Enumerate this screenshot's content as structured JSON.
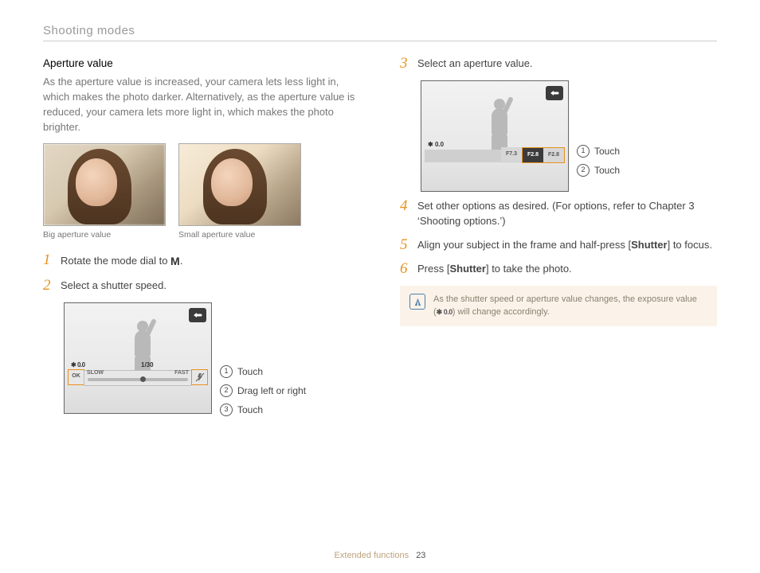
{
  "section_title": "Shooting modes",
  "left": {
    "subhead": "Aperture value",
    "body": "As the aperture value is increased, your camera lets less light in, which makes the photo darker. Alternatively, as the aperture value is reduced, your camera lets more light in, which makes the photo brighter.",
    "cap_big": "Big aperture value",
    "cap_small": "Small aperture value",
    "step1_pre": "Rotate the mode dial to ",
    "step1_post": ".",
    "mode_letter": "M",
    "step2": "Select a shutter speed.",
    "screen1": {
      "ev": "0.0",
      "shutter": "1/30",
      "slow": "SLOW",
      "fast": "FAST",
      "ok": "OK"
    },
    "callouts": {
      "c1_num": "1",
      "c1": "Touch",
      "c2_num": "2",
      "c2": "Drag left or right",
      "c3_num": "3",
      "c3": "Touch"
    }
  },
  "right": {
    "step3": "Select an aperture value.",
    "screen2": {
      "ev": "0.0",
      "f1": "F7.3",
      "f2": "F2.8",
      "f3": "F2.8"
    },
    "callouts2": {
      "c1_num": "1",
      "c1": "Touch",
      "c2_num": "2",
      "c2": "Touch"
    },
    "step4": "Set other options as desired. (For options, refer to Chapter 3 ‘Shooting options.’)",
    "step5_pre": "Align your subject in the frame and half-press [",
    "step5_bold": "Shutter",
    "step5_post": "] to focus.",
    "step6_pre": "Press [",
    "step6_bold": "Shutter",
    "step6_post": "] to take the photo.",
    "note_pre": "As the shutter speed or aperture value changes, the exposure value (",
    "note_ev": "0.0",
    "note_post": ") will change accordingly."
  },
  "nums": {
    "n1": "1",
    "n2": "2",
    "n3": "3",
    "n4": "4",
    "n5": "5",
    "n6": "6"
  },
  "footer": {
    "label": "Extended functions",
    "page": "23"
  }
}
